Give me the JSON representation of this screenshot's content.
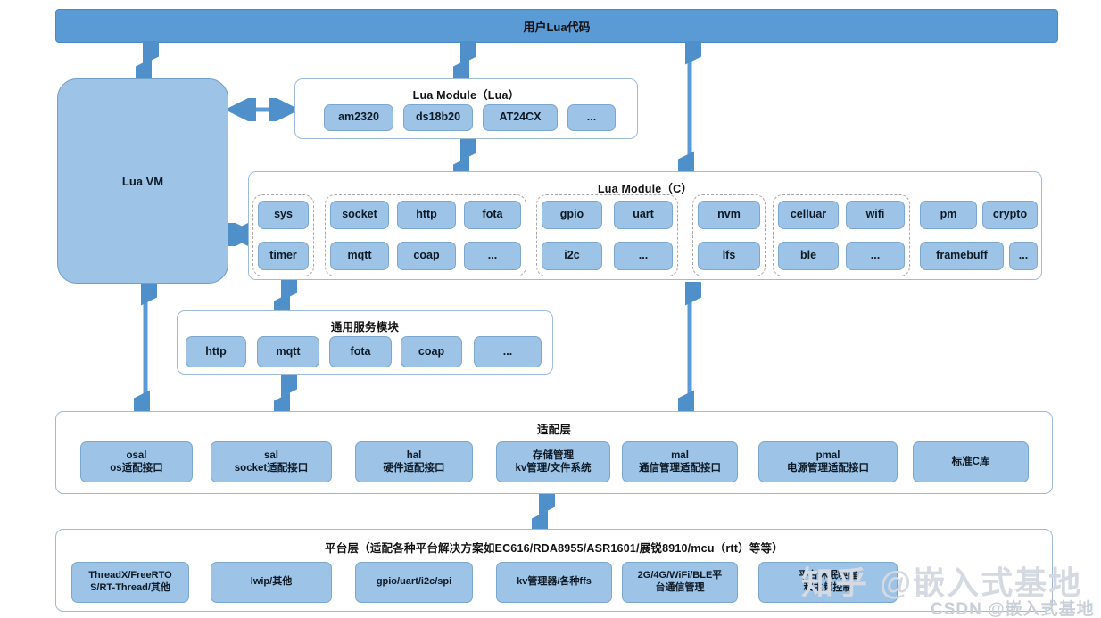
{
  "diagram": {
    "top_banner": {
      "label": "用户Lua代码"
    },
    "lua_vm": {
      "label": "Lua VM"
    },
    "lua_module_lua": {
      "title": "Lua Module（Lua）",
      "items": [
        "am2320",
        "ds18b20",
        "AT24CX",
        "..."
      ]
    },
    "lua_module_c": {
      "title": "Lua Module（C）",
      "groups": [
        {
          "dashed": true,
          "rows": [
            [
              "sys"
            ],
            [
              "timer"
            ]
          ]
        },
        {
          "dashed": true,
          "rows": [
            [
              "socket",
              "http",
              "fota"
            ],
            [
              "mqtt",
              "coap",
              "..."
            ]
          ]
        },
        {
          "dashed": true,
          "rows": [
            [
              "gpio",
              "uart"
            ],
            [
              "i2c",
              "..."
            ]
          ]
        },
        {
          "dashed": true,
          "rows": [
            [
              "nvm"
            ],
            [
              "lfs"
            ]
          ]
        },
        {
          "dashed": true,
          "rows": [
            [
              "celluar",
              "wifi"
            ],
            [
              "ble",
              "..."
            ]
          ]
        },
        {
          "dashed": false,
          "rows": [
            [
              "pm",
              "crypto"
            ],
            [
              "framebuff",
              "..."
            ]
          ]
        }
      ]
    },
    "common_service": {
      "title": "通用服务模块",
      "items": [
        "http",
        "mqtt",
        "fota",
        "coap",
        "..."
      ]
    },
    "adaptation_layer": {
      "title": "适配层",
      "items": [
        {
          "line1": "osal",
          "line2": "os适配接口"
        },
        {
          "line1": "sal",
          "line2": "socket适配接口"
        },
        {
          "line1": "hal",
          "line2": "硬件适配接口"
        },
        {
          "line1": "存储管理",
          "line2": "kv管理/文件系统"
        },
        {
          "line1": "mal",
          "line2": "通信管理适配接口"
        },
        {
          "line1": "pmal",
          "line2": "电源管理适配接口"
        },
        {
          "line1": "标准C库",
          "line2": ""
        }
      ]
    },
    "platform_layer": {
      "title": "平台层（适配各种平台解决方案如EC616/RDA8955/ASR1601/展锐8910/mcu（rtt）等等）",
      "items": [
        {
          "line1": "ThreadX/FreeRTO",
          "line2": "S/RT-Thread/其他"
        },
        {
          "line1": "lwip/其他",
          "line2": ""
        },
        {
          "line1": "gpio/uart/i2c/spi",
          "line2": ""
        },
        {
          "line1": "kv管理器/各种ffs",
          "line2": ""
        },
        {
          "line1": "2G/4G/WiFi/BLE平",
          "line2": "台通信管理"
        },
        {
          "line1": "平台休眠唤醒",
          "line2": "和主频控制"
        }
      ]
    },
    "watermark": {
      "main": "知乎 @嵌入式基地",
      "sub": "CSDN @嵌入式基地"
    },
    "colors": {
      "banner_fill": "#5b9bd5",
      "chip_fill": "#9dc3e6",
      "chip_border": "#7ba7cf",
      "panel_border": "#9dbbd9",
      "arrow": "#5b9bd5",
      "dashed_border": "#a6a6a6"
    }
  }
}
